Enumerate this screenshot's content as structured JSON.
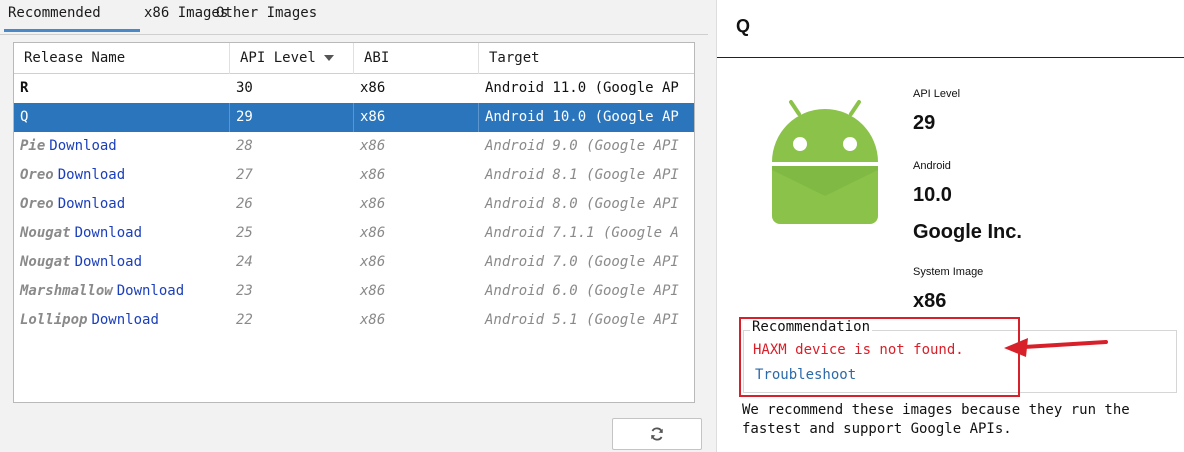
{
  "tabs": {
    "recommended": "Recommended",
    "x86": "x86 Images",
    "other": "Other Images"
  },
  "table": {
    "headers": {
      "release": "Release Name",
      "api": "API Level",
      "abi": "ABI",
      "target": "Target"
    },
    "download_label": "Download",
    "rows": [
      {
        "name": "R",
        "api": "30",
        "abi": "x86",
        "target": "Android 11.0 (Google AP",
        "state": "available"
      },
      {
        "name": "Q",
        "api": "29",
        "abi": "x86",
        "target": "Android 10.0 (Google AP",
        "state": "selected"
      },
      {
        "name": "Pie",
        "api": "28",
        "abi": "x86",
        "target": "Android 9.0 (Google API",
        "state": "missing"
      },
      {
        "name": "Oreo",
        "api": "27",
        "abi": "x86",
        "target": "Android 8.1 (Google API",
        "state": "missing"
      },
      {
        "name": "Oreo",
        "api": "26",
        "abi": "x86",
        "target": "Android 8.0 (Google API",
        "state": "missing"
      },
      {
        "name": "Nougat",
        "api": "25",
        "abi": "x86",
        "target": "Android 7.1.1 (Google A",
        "state": "missing"
      },
      {
        "name": "Nougat",
        "api": "24",
        "abi": "x86",
        "target": "Android 7.0 (Google API",
        "state": "missing"
      },
      {
        "name": "Marshmallow",
        "api": "23",
        "abi": "x86",
        "target": "Android 6.0 (Google API",
        "state": "missing"
      },
      {
        "name": "Lollipop",
        "api": "22",
        "abi": "x86",
        "target": "Android 5.1 (Google API",
        "state": "missing"
      }
    ]
  },
  "refresh_icon": "refresh-icon",
  "detail": {
    "title": "Q",
    "api_label": "API Level",
    "api_value": "29",
    "android_label": "Android",
    "android_value": "10.0",
    "vendor": "Google Inc.",
    "system_image_label": "System Image",
    "system_image_value": "x86",
    "recommendation_legend": "Recommendation",
    "recommendation_error": "HAXM device is not found.",
    "troubleshoot": "Troubleshoot",
    "note": "We recommend these images because they run the fastest and support Google APIs."
  },
  "colors": {
    "selection": "#2a75bb",
    "error": "#d8202a",
    "link": "#1b3fbb",
    "android_green": "#8bc34a",
    "tab_accent": "#4a88c7"
  }
}
